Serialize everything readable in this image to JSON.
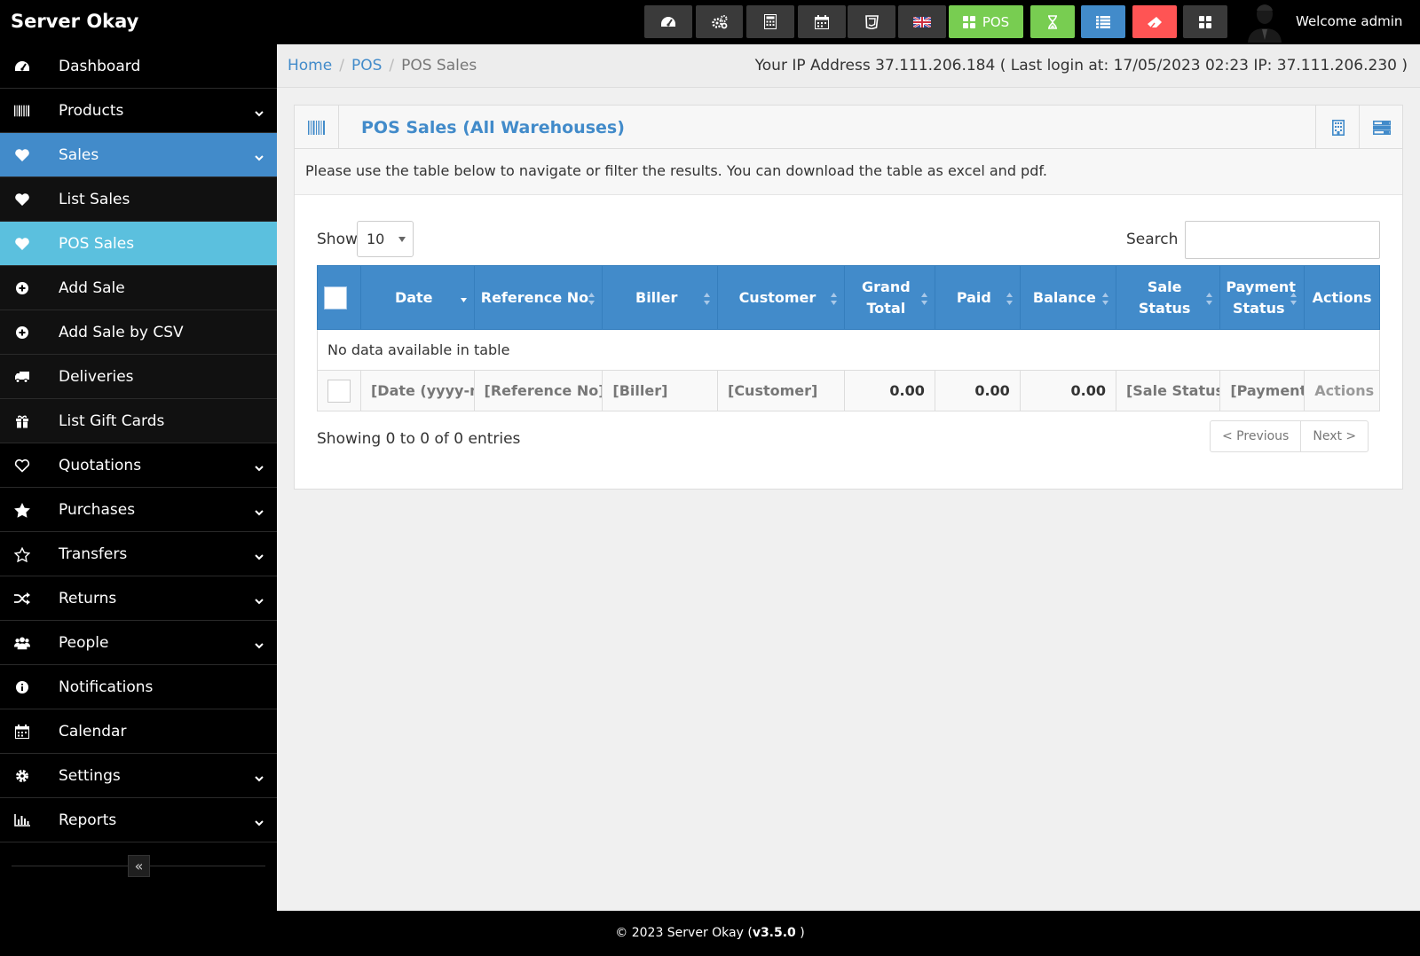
{
  "brand": "Server Okay",
  "topbar": {
    "buttons": [
      {
        "name": "dashboard-button",
        "icon": "dashboard-icon"
      },
      {
        "name": "settings-button",
        "icon": "cogs-icon"
      },
      {
        "name": "calculator-button",
        "icon": "calculator-icon"
      },
      {
        "name": "calendar-button",
        "icon": "calendar-icon"
      },
      {
        "name": "styles-button",
        "icon": "css3-icon"
      },
      {
        "name": "language-button",
        "icon": "uk-flag-icon"
      },
      {
        "name": "pos-button",
        "icon": "th-large-icon",
        "label": "POS"
      },
      {
        "name": "register-button",
        "icon": "hourglass-icon"
      },
      {
        "name": "list-button",
        "icon": "list-icon"
      },
      {
        "name": "clear-button",
        "icon": "eraser-icon"
      },
      {
        "name": "apps-button",
        "icon": "th-large-icon"
      }
    ],
    "pos_label": "POS",
    "welcome": "Welcome admin"
  },
  "sidebar": {
    "items": [
      {
        "label": "Dashboard",
        "icon": "dashboard-icon"
      },
      {
        "label": "Products",
        "icon": "barcode-icon",
        "expandable": true
      },
      {
        "label": "Sales",
        "icon": "heart-icon",
        "expandable": true,
        "state": "active"
      },
      {
        "label": "List Sales",
        "icon": "heart-icon",
        "state": "sub"
      },
      {
        "label": "POS Sales",
        "icon": "heart-icon",
        "state": "current"
      },
      {
        "label": "Add Sale",
        "icon": "plus-circle-icon",
        "state": "sub"
      },
      {
        "label": "Add Sale by CSV",
        "icon": "plus-circle-icon",
        "state": "sub"
      },
      {
        "label": "Deliveries",
        "icon": "truck-icon",
        "state": "sub"
      },
      {
        "label": "List Gift Cards",
        "icon": "gift-icon",
        "state": "sub"
      },
      {
        "label": "Quotations",
        "icon": "heart-outline-icon",
        "expandable": true
      },
      {
        "label": "Purchases",
        "icon": "star-icon",
        "expandable": true
      },
      {
        "label": "Transfers",
        "icon": "star-outline-icon",
        "expandable": true
      },
      {
        "label": "Returns",
        "icon": "random-icon",
        "expandable": true
      },
      {
        "label": "People",
        "icon": "users-icon",
        "expandable": true
      },
      {
        "label": "Notifications",
        "icon": "info-circle-icon"
      },
      {
        "label": "Calendar",
        "icon": "calendar-icon"
      },
      {
        "label": "Settings",
        "icon": "cog-icon",
        "expandable": true
      },
      {
        "label": "Reports",
        "icon": "bar-chart-icon",
        "expandable": true
      }
    ],
    "collapse_glyph": "«"
  },
  "breadcrumb": {
    "home": "Home",
    "pos": "POS",
    "current": "POS Sales"
  },
  "ip_info": "Your IP Address 37.111.206.184 ( Last login at: 17/05/2023 02:23 IP: 37.111.206.230 )",
  "box": {
    "title": "POS Sales (All Warehouses)",
    "intro": "Please use the table below to navigate or filter the results. You can download the table as excel and pdf."
  },
  "table_controls": {
    "show_label": "Show",
    "page_size": "10",
    "search_label": "Search",
    "search_value": ""
  },
  "table": {
    "columns": [
      "Date",
      "Reference No",
      "Biller",
      "Customer",
      "Grand Total",
      "Paid",
      "Balance",
      "Sale Status",
      "Payment Status",
      "Actions"
    ],
    "empty_message": "No data available in table",
    "filters": [
      "[Date (yyyy-mm-dd)]",
      "[Reference No]",
      "[Biller]",
      "[Customer]",
      "0.00",
      "0.00",
      "0.00",
      "[Sale Status]",
      "[Payment Status]",
      "Actions"
    ]
  },
  "pagination": {
    "summary": "Showing 0 to 0 of 0 entries",
    "previous": "< Previous",
    "next": "Next >"
  },
  "footer": {
    "copyright": "© 2023 Server Okay (",
    "version": "v3.5.0",
    "close": " )"
  },
  "colors": {
    "primary": "#428bca",
    "info": "#5bc0de",
    "success": "#78cd51",
    "danger": "#ff5454"
  }
}
